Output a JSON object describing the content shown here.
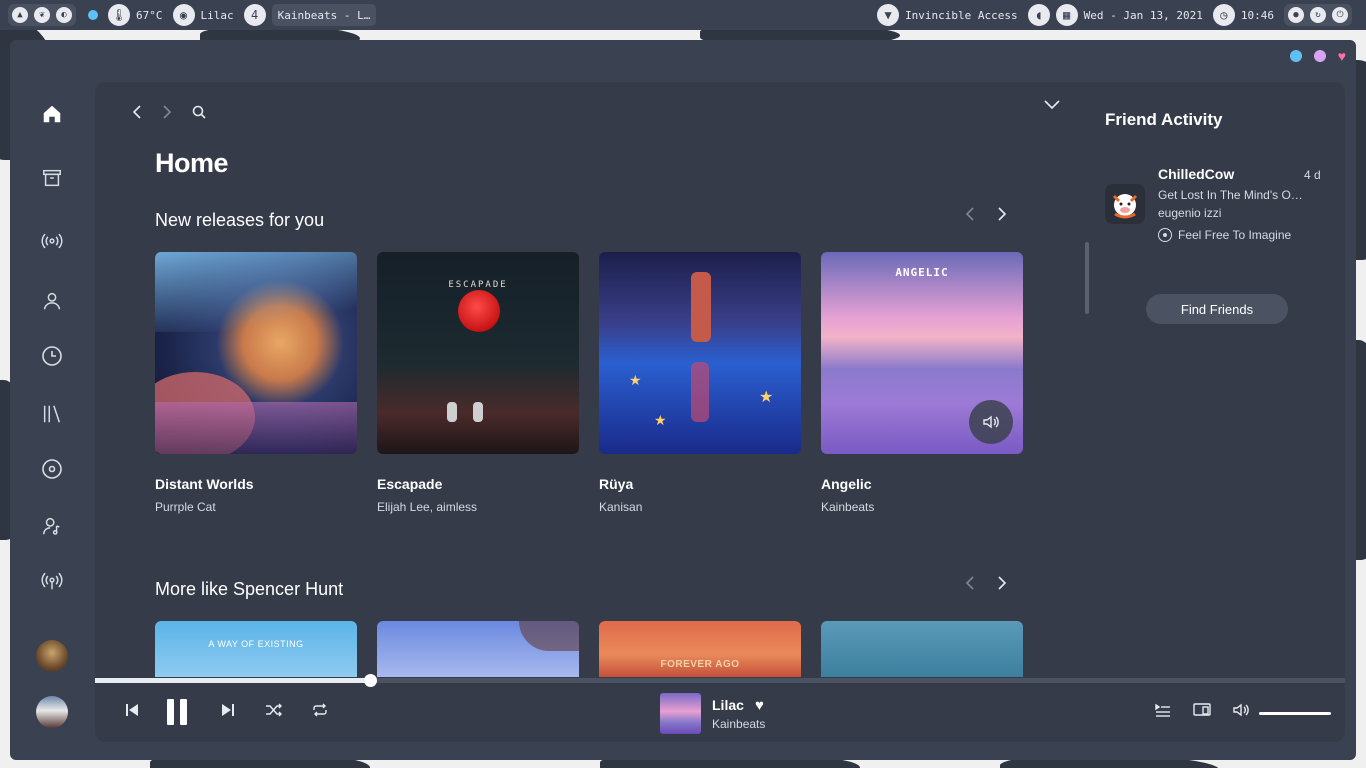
{
  "topbar": {
    "temperature": "67°C",
    "song": "Lilac",
    "workspace_count": "4",
    "window_title": "Kainbeats - L…",
    "network": "Invincible Access",
    "date": "Wed - Jan 13, 2021",
    "time": "10:46"
  },
  "window_dots": {
    "colors": [
      "#5fc0f5",
      "#d9a3f5",
      "#ff6fa8"
    ]
  },
  "sidebar": {
    "items": [
      {
        "icon": "home-icon"
      },
      {
        "icon": "archive-icon"
      },
      {
        "icon": "radio-icon"
      },
      {
        "icon": "user-icon"
      },
      {
        "icon": "clock-icon"
      },
      {
        "icon": "library-icon"
      },
      {
        "icon": "disc-icon"
      },
      {
        "icon": "artist-icon"
      },
      {
        "icon": "podcast-icon"
      }
    ]
  },
  "main": {
    "title": "Home",
    "section1": {
      "title": "New releases for you",
      "cards": [
        {
          "title": "Distant Worlds",
          "subtitle": "Purrple Cat"
        },
        {
          "title": "Escapade",
          "subtitle": "Elijah Lee, aimless",
          "cover_text": "ESCAPADE"
        },
        {
          "title": "Rüya",
          "subtitle": "Kanisan"
        },
        {
          "title": "Angelic",
          "subtitle": "Kainbeats",
          "cover_text": "ANGELIC"
        }
      ]
    },
    "section2": {
      "title": "More like Spencer Hunt",
      "cover_texts": [
        "A WAY OF EXISTING",
        "",
        "FOREVER AGO",
        ""
      ]
    }
  },
  "friend_activity": {
    "title": "Friend Activity",
    "friend": {
      "name": "ChilledCow",
      "time": "4 d",
      "track": "Get Lost In The Mind's O…",
      "artist": "eugenio izzi",
      "context": "Feel Free To Imagine"
    },
    "find_button": "Find Friends"
  },
  "player": {
    "progress_fraction": 0.22,
    "title": "Lilac",
    "artist": "Kainbeats",
    "volume_fraction": 1.0
  }
}
